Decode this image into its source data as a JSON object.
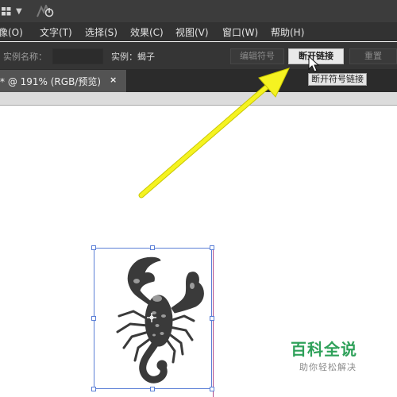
{
  "menu": [
    "像(O)",
    "文字(T)",
    "选择(S)",
    "效果(C)",
    "视图(V)",
    "窗口(W)",
    "帮助(H)"
  ],
  "control_bar": {
    "instance_name_label": "实例名称：",
    "instance_name_value": "",
    "instance_label": "实例：蝎子",
    "edit_symbol_button": "编辑符号",
    "break_link_button": "断开链接",
    "reset_button": "重置"
  },
  "tooltip": "断开符号链接",
  "document_tab": {
    "title": "* @ 191% (RGB/预览)",
    "close": "×"
  },
  "icons": [
    "workspace-grid-icon",
    "chevron-down-icon",
    "sync-icon",
    "pointer-cursor-icon",
    "scorpion-icon",
    "center-point-icon"
  ],
  "annotation": {
    "arrow_color": "#f5f321"
  },
  "colors": {
    "menubar_bg": "#323232",
    "selection_blue": "#5b7fd6",
    "guide_magenta": "#b04a8a",
    "watermark_green": "#2fa15a"
  },
  "watermark": {
    "title": "百科全说",
    "subtitle": "助你轻松解决"
  }
}
